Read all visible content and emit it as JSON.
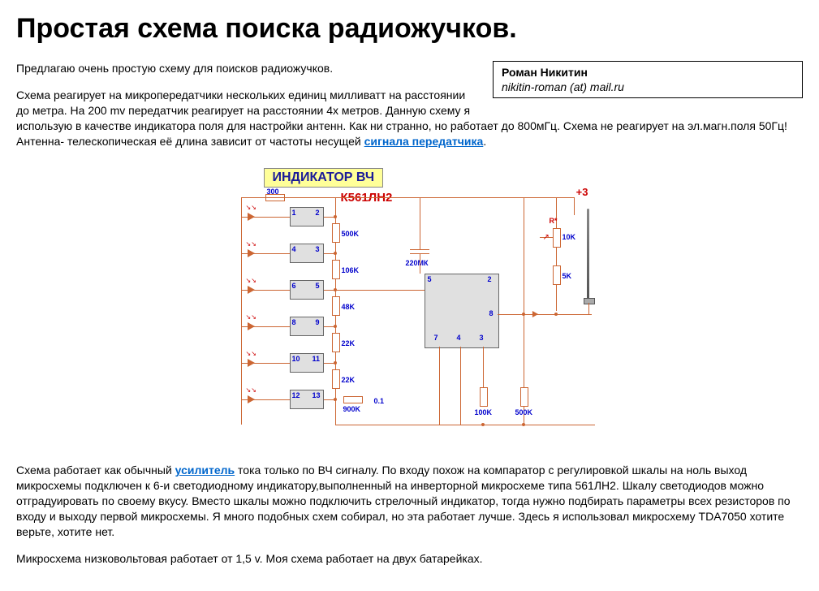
{
  "title": "Простая схема поиска радиожучков.",
  "author": {
    "name": "Роман Никитин",
    "contact": "nikitin-roman (at) mail.ru"
  },
  "intro": "Предлагаю очень простую схему для поисков радиожучков.",
  "p2a": "Схема реагирует на микропередатчики нескольких единиц милливатт на расстоянии до метра. На 200 mv передатчик реагирует на расстоянии 4x метров. Данную схему я использую в качестве индикатора поля для настройки антенн. Как ни странно, но работает до 800мГц. Схема не реагирует на эл.магн.поля 50Гц! Антенна- телескопическая её длина зависит от частоты несущей ",
  "p2_link": "сигнала передатчика",
  "p2b": ".",
  "schematic": {
    "title": "ИНДИКАТОР ВЧ",
    "chip": "К561ЛН2",
    "power": "+3",
    "inverters": [
      {
        "pin_in": "1",
        "pin_out": "2",
        "r_val": "500K"
      },
      {
        "pin_in": "4",
        "pin_out": "3",
        "r_val": "106K"
      },
      {
        "pin_in": "6",
        "pin_out": "5",
        "r_val": "48K"
      },
      {
        "pin_in": "8",
        "pin_out": "9",
        "r_val": "22K"
      },
      {
        "pin_in": "10",
        "pin_out": "11",
        "r_val": "22K"
      },
      {
        "pin_in": "12",
        "pin_out": "13",
        "r_val": "900K"
      }
    ],
    "top_res": "300",
    "cap_label": "220МК",
    "r_star": "R*",
    "r_star_val": "10K",
    "r_ant": "5K",
    "r_bot1": "100K",
    "r_bot2": "500K",
    "pins_big": {
      "p5": "5",
      "p2": "2",
      "p8": "8",
      "p7": "7",
      "p4": "4",
      "p3": "3"
    },
    "last_row_extra": "0.1"
  },
  "p3a": "Схема работает как обычный ",
  "p3_link": "усилитель",
  "p3b": " тока только по ВЧ сигналу. По входу похож на компаратор с регулировкой шкалы на ноль выход микросхемы подключен к 6-и светодиодному индикатору,выполненный на инверторной микросхеме типа 561ЛН2. Шкалу светодиодов можно отградуировать по своему вкусу. Вместо шкалы можно подключить стрелочный индикатор, тогда нужно подбирать параметры всех резисторов по входу и выходу первой микросхемы. Я много подобных схем собирал, но эта работает лучше. Здесь я использовал микросхему TDA7050 хотите верьте, хотите нет.",
  "p4": "Микросхема низковольтовая работает от 1,5 v. Моя схема работает на двух батарейках."
}
